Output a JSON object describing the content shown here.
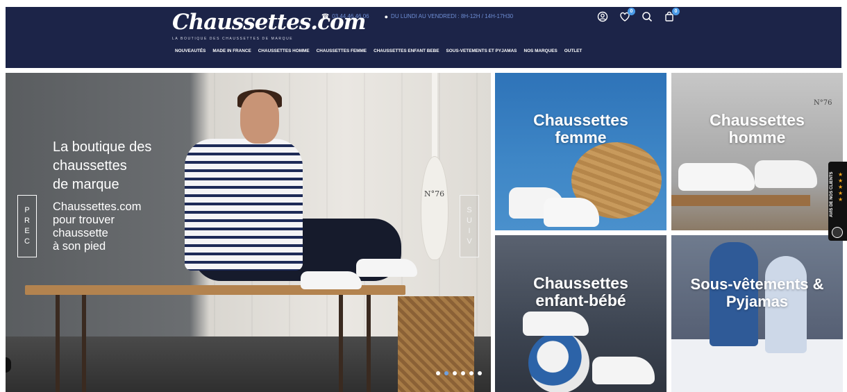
{
  "header": {
    "logo_text": "Chaussettes.com",
    "logo_tagline": "LA BOUTIQUE DES CHAUSSETTES DE MARQUE",
    "phone": "03.44.46.46.06",
    "hours": "DU LUNDI AU VENDREDI : 8H-12H / 14H-17H30",
    "wishlist_count": "0",
    "cart_count": "0",
    "icons": [
      "phone-icon",
      "clock-icon",
      "account-icon",
      "wishlist-heart-icon",
      "search-icon",
      "cart-bag-icon"
    ]
  },
  "nav": {
    "items": [
      {
        "label": "NOUVEAUTÉS"
      },
      {
        "label": "MADE IN FRANCE"
      },
      {
        "label": "CHAUSSETTES HOMME"
      },
      {
        "label": "CHAUSSETTES FEMME"
      },
      {
        "label": "CHAUSSETTES ENFANT BEBE"
      },
      {
        "label": "SOUS-VETEMENTS ET PYJAMAS"
      },
      {
        "label": "NOS MARQUES"
      },
      {
        "label": "OUTLET"
      }
    ]
  },
  "hero": {
    "title": "La boutique des\nchaussettes\nde marque",
    "subtitle": "Chaussettes.com\npour trouver\nchaussette\nà son pied",
    "prev_label": [
      "P",
      "R",
      "E",
      "C"
    ],
    "next_label": [
      "S",
      "U",
      "I",
      "V"
    ],
    "oar_text": "N°76",
    "dots_total": 6,
    "dots_active": 1
  },
  "tiles": {
    "femme": "Chaussettes\nfemme",
    "homme": "Chaussettes\nhomme",
    "homme_mark": "N°76",
    "enfant": "Chaussettes\nenfant-bébé",
    "pyjama": "Sous-vêtements &\nPyjamas"
  },
  "reviews_widget": {
    "label": "AVIS DE NOS CLIENTS",
    "star_color": "#f4a51c"
  },
  "colors": {
    "header_bg": "#1c2448",
    "accent": "#4a9be8"
  }
}
